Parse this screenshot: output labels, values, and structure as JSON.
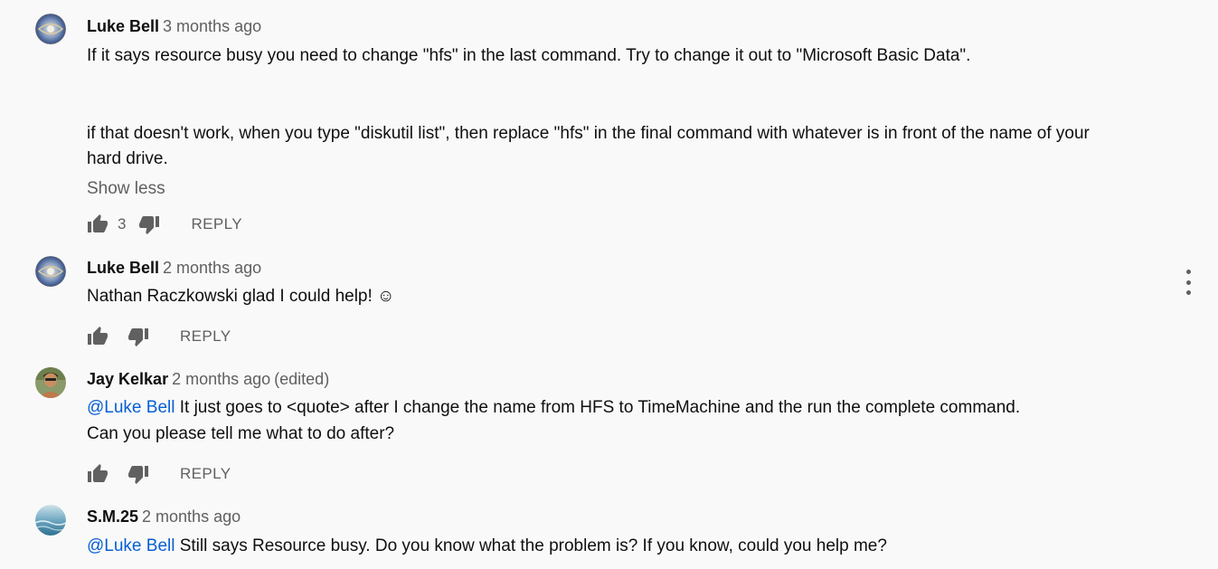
{
  "comments": [
    {
      "author": "Luke Bell",
      "time": "3 months ago",
      "paragraphs": [
        "If it says resource busy you need to change \"hfs\" in the last command. Try to change it out to \"Microsoft Basic Data\".",
        "if that doesn't work, when you type \"diskutil list\", then replace \"hfs\" in the final command with whatever is in front of the name of your",
        "hard drive."
      ],
      "show_less": "Show less",
      "likes": "3",
      "reply": "REPLY",
      "avatar_icon": "swirl-avatar-icon"
    },
    {
      "author": "Luke Bell",
      "time": "2 months ago",
      "text": "Nathan Raczkowski glad I could help! ☺",
      "reply": "REPLY",
      "avatar_icon": "swirl-avatar-icon"
    },
    {
      "author": "Jay Kelkar",
      "time": "2 months ago",
      "edited": "(edited)",
      "mention": "@Luke Bell",
      "text_line1": " It just goes to <quote> after I change the name from HFS to TimeMachine and the run the complete command.",
      "text_line2": "Can you please tell me what to do after?",
      "reply": "REPLY",
      "avatar_icon": "person-avatar-icon"
    },
    {
      "author": "S.M.25",
      "time": "2 months ago",
      "mention": "@Luke Bell",
      "text": " Still says Resource busy. Do you know what the problem is? If you know, could you help me?",
      "avatar_icon": "water-avatar-icon"
    }
  ],
  "icons": {
    "like": "thumb-up-icon",
    "dislike": "thumb-down-icon",
    "more": "more-vertical-icon"
  },
  "colors": {
    "background": "#f9f9f9",
    "text": "#0f0f0f",
    "secondary": "#606060",
    "link": "#065fd4"
  }
}
